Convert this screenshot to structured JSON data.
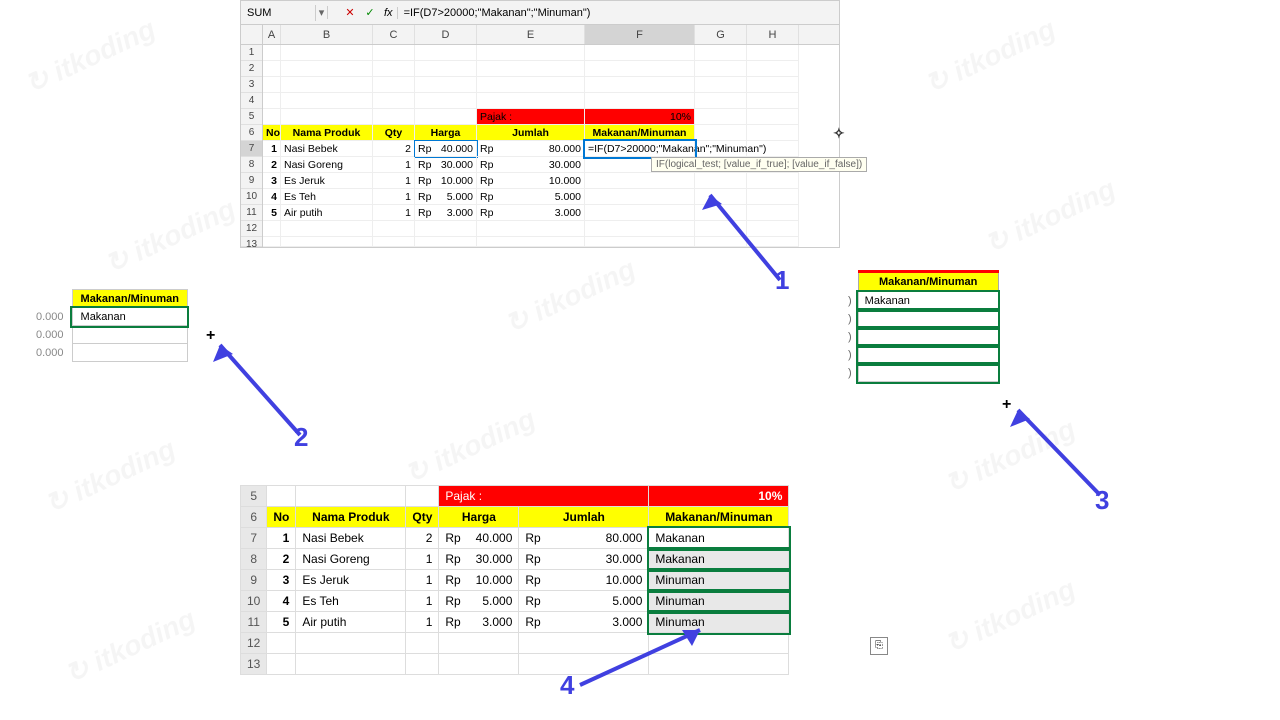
{
  "formula_bar": {
    "name_box": "SUM",
    "cancel": "✕",
    "confirm": "✓",
    "fx": "fx",
    "formula": "=IF(D7>20000;\"Makanan\";\"Minuman\")"
  },
  "columns": [
    "A",
    "B",
    "C",
    "D",
    "E",
    "F",
    "G",
    "H"
  ],
  "rows_top": [
    "1",
    "2",
    "3",
    "4",
    "5",
    "6",
    "7",
    "8",
    "9",
    "10",
    "11",
    "12",
    "13"
  ],
  "pajak_label": "Pajak :",
  "pajak_value": "10%",
  "headers": {
    "no": "No",
    "nama": "Nama Produk",
    "qty": "Qty",
    "harga": "Harga",
    "jumlah": "Jumlah",
    "mm": "Makanan/Minuman"
  },
  "rows_data": [
    {
      "no": "1",
      "nama": "Nasi Bebek",
      "qty": "2",
      "rp": "Rp",
      "harga": "40.000",
      "rp2": "Rp",
      "jumlah": "80.000"
    },
    {
      "no": "2",
      "nama": "Nasi Goreng",
      "qty": "1",
      "rp": "Rp",
      "harga": "30.000",
      "rp2": "Rp",
      "jumlah": "30.000"
    },
    {
      "no": "3",
      "nama": "Es Jeruk",
      "qty": "1",
      "rp": "Rp",
      "harga": "10.000",
      "rp2": "Rp",
      "jumlah": "10.000"
    },
    {
      "no": "4",
      "nama": "Es Teh",
      "qty": "1",
      "rp": "Rp",
      "harga": "5.000",
      "rp2": "Rp",
      "jumlah": "5.000"
    },
    {
      "no": "5",
      "nama": "Air putih",
      "qty": "1",
      "rp": "Rp",
      "harga": "3.000",
      "rp2": "Rp",
      "jumlah": "3.000"
    }
  ],
  "editing_formula": "=IF(D7>20000;\"Makanan\";\"Minuman\")",
  "tooltip": "IF(logical_test; [value_if_true]; [value_if_false])",
  "cross_icon": "✧",
  "panel2": {
    "header": "Makanan/Minuman",
    "val": "Makanan",
    "side": [
      "0.000",
      "0.000",
      "0.000"
    ],
    "plus": "+"
  },
  "panel3": {
    "header": "Makanan/Minuman",
    "val": "Makanan",
    "paren": ")",
    "plus": "+"
  },
  "panel4": {
    "rowh": [
      "5",
      "6",
      "7",
      "8",
      "9",
      "10",
      "11",
      "12",
      "13"
    ],
    "pajak": "Pajak :",
    "pajak_pct": "10%",
    "results": [
      "Makanan",
      "Makanan",
      "Minuman",
      "Minuman",
      "Minuman"
    ],
    "autofill_icon": "⎘"
  },
  "callouts": {
    "n1": "1",
    "n2": "2",
    "n3": "3",
    "n4": "4"
  }
}
